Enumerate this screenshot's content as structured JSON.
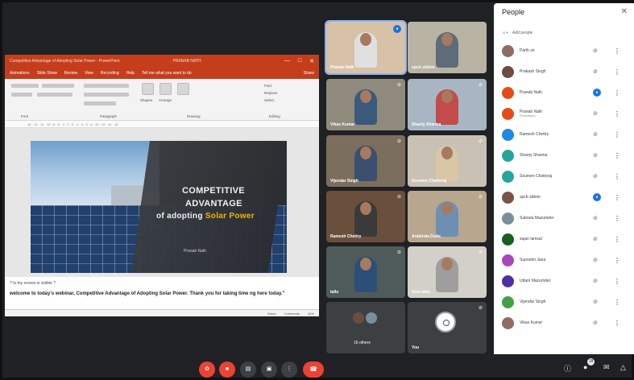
{
  "presentation": {
    "window_title": "Competitive Advantage of Adopting Solar Power - PowerPoint",
    "user_badge": "PRANAB NATH",
    "tabs": [
      "Animations",
      "Slide Show",
      "Review",
      "View",
      "Recording",
      "Help",
      "Tell me what you want to do",
      "Share"
    ],
    "ribbon_groups": [
      "Font",
      "Paragraph",
      "Drawing",
      "Editing"
    ],
    "ribbon_buttons": [
      "Shapes",
      "Arrange",
      "Find",
      "Replace",
      "Select"
    ],
    "ruler": "16 · 14 · 12 · 10 · 8 · 6 · 4 · 2 · 0 · 2 · 4 · 6 · 8 · 10 · 12 · 14 · 16",
    "slide": {
      "line1": "COMPETITIVE",
      "line2": "ADVANTAGE",
      "line3_prefix": "of adopting ",
      "line3_accent": "Solar Power",
      "author": "Pranab Nath"
    },
    "question": "? Is my screen is visible ?",
    "notes": "welcome to today's webinar, Competitive Advantage of Adopting Solar Power. Thank you for taking time ng here today.\"",
    "status": [
      "Notes",
      "Comments",
      "44%"
    ]
  },
  "tiles": [
    {
      "name": "Pranab Nath",
      "active": true,
      "muted": false
    },
    {
      "name": "spcb sikkim",
      "active": false,
      "muted": false
    },
    {
      "name": "Vikas Kumar",
      "active": false,
      "muted": true
    },
    {
      "name": "Shanty Sharma",
      "active": false,
      "muted": true
    },
    {
      "name": "Vijendar Singh",
      "active": false,
      "muted": true
    },
    {
      "name": "Soumen Chattoraj",
      "active": false,
      "muted": true
    },
    {
      "name": "Ramesh Chettry",
      "active": false,
      "muted": true
    },
    {
      "name": "Arabinda Dutta",
      "active": false,
      "muted": true
    },
    {
      "name": "tallu",
      "active": false,
      "muted": true
    },
    {
      "name": "Geet ebm",
      "active": false,
      "muted": true
    },
    {
      "name": "16 others",
      "active": false,
      "muted": false
    },
    {
      "name": "You",
      "active": false,
      "muted": true
    }
  ],
  "people": {
    "title": "People",
    "close": "✕",
    "add_label": "Add people",
    "items": [
      {
        "name": "Parth sri",
        "sub": "",
        "color": "#8d6e63",
        "mic": "muted"
      },
      {
        "name": "Prakash Singh",
        "sub": "",
        "color": "#6d4c41",
        "mic": "muted"
      },
      {
        "name": "Pranab Nath",
        "sub": "",
        "color": "#e64a19",
        "mic": "on"
      },
      {
        "name": "Pranab Nath",
        "sub": "Presentation",
        "color": "#e64a19",
        "mic": "muted"
      },
      {
        "name": "Ramesh Chettry",
        "sub": "",
        "color": "#1e88e5",
        "mic": "muted"
      },
      {
        "name": "Shanty Sharma",
        "sub": "",
        "color": "#26a69a",
        "mic": "muted"
      },
      {
        "name": "Soumen Chattoraj",
        "sub": "",
        "color": "#26a69a",
        "mic": "muted"
      },
      {
        "name": "spcb sikkim",
        "sub": "",
        "color": "#795548",
        "mic": "on"
      },
      {
        "name": "Subrata Mazumder",
        "sub": "",
        "color": "#78909c",
        "mic": "muted"
      },
      {
        "name": "sujan lamsal",
        "sub": "",
        "color": "#1b5e20",
        "mic": "muted"
      },
      {
        "name": "Supratim Jana",
        "sub": "",
        "color": "#ab47bc",
        "mic": "muted"
      },
      {
        "name": "Uttam Mazumder",
        "sub": "",
        "color": "#512da8",
        "mic": "muted"
      },
      {
        "name": "Vijendar Singh",
        "sub": "",
        "color": "#43a047",
        "mic": "muted"
      },
      {
        "name": "Vikas Kumar",
        "sub": "",
        "color": "#8d6e63",
        "mic": "muted"
      }
    ]
  },
  "controls": {
    "people_count": "18",
    "mic_icon": "mic-off-icon",
    "cam_icon": "camera-off-icon"
  }
}
